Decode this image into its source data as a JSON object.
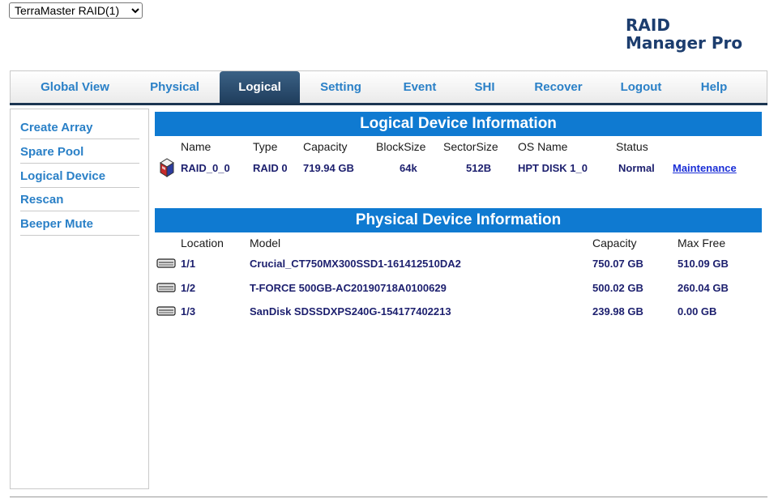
{
  "controller_select": {
    "value": "TerraMaster RAID(1)",
    "options": [
      "TerraMaster RAID(1)"
    ]
  },
  "brand": {
    "line1": "RAID",
    "line2": "Manager Pro"
  },
  "tabs": [
    {
      "label": "Global View",
      "active": false
    },
    {
      "label": "Physical",
      "active": false
    },
    {
      "label": "Logical",
      "active": true
    },
    {
      "label": "Setting",
      "active": false
    },
    {
      "label": "Event",
      "active": false
    },
    {
      "label": "SHI",
      "active": false
    },
    {
      "label": "Recover",
      "active": false
    },
    {
      "label": "Logout",
      "active": false
    },
    {
      "label": "Help",
      "active": false
    }
  ],
  "sidebar": {
    "items": [
      {
        "label": "Create Array"
      },
      {
        "label": "Spare Pool"
      },
      {
        "label": "Logical Device"
      },
      {
        "label": "Rescan"
      },
      {
        "label": "Beeper Mute"
      }
    ]
  },
  "logical": {
    "title": "Logical Device Information",
    "headers": {
      "name": "Name",
      "type": "Type",
      "capacity": "Capacity",
      "blocksize": "BlockSize",
      "sectorsize": "SectorSize",
      "osname": "OS Name",
      "status": "Status"
    },
    "rows": [
      {
        "icon": "raid-array-icon",
        "name": "RAID_0_0",
        "type": "RAID 0",
        "capacity": "719.94 GB",
        "blocksize": "64k",
        "sectorsize": "512B",
        "osname": "HPT DISK 1_0",
        "status": "Normal",
        "action": "Maintenance"
      }
    ]
  },
  "physical": {
    "title": "Physical Device Information",
    "headers": {
      "location": "Location",
      "model": "Model",
      "capacity": "Capacity",
      "maxfree": "Max Free"
    },
    "rows": [
      {
        "icon": "disk-drive-icon",
        "location": "1/1",
        "model": "Crucial_CT750MX300SSD1-161412510DA2",
        "capacity": "750.07 GB",
        "maxfree": "510.09 GB"
      },
      {
        "icon": "disk-drive-icon",
        "location": "1/2",
        "model": "T-FORCE 500GB-AC20190718A0100629",
        "capacity": "500.02 GB",
        "maxfree": "260.04 GB"
      },
      {
        "icon": "disk-drive-icon",
        "location": "1/3",
        "model": "SanDisk SDSSDXPS240G-154177402213",
        "capacity": "239.98 GB",
        "maxfree": "0.00 GB"
      }
    ]
  },
  "colors": {
    "accent": "#0f7ad1",
    "link": "#2a80c7",
    "active_tab": "#2b4e71",
    "data_text": "#1c1f6e"
  }
}
